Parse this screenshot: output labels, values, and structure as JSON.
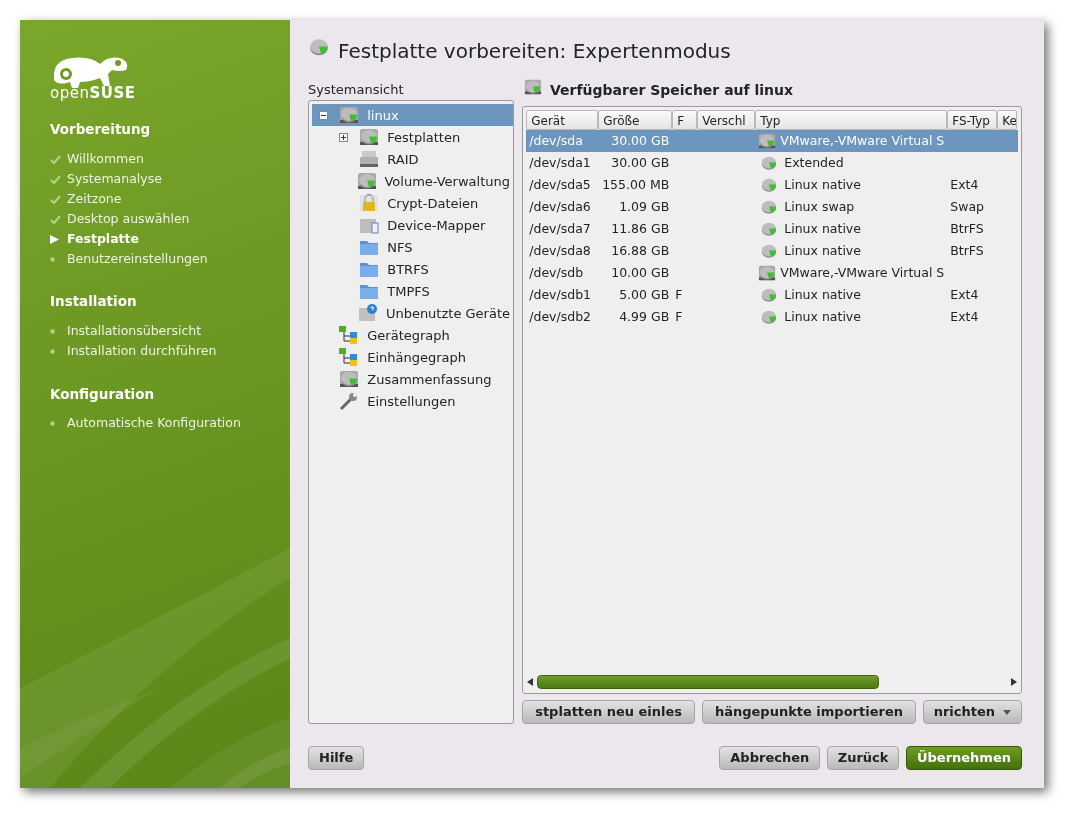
{
  "sidebar": {
    "logo": "open**SUSE**",
    "sections": [
      {
        "title": "Vorbereitung",
        "steps": [
          {
            "label": "Willkommen",
            "done": true,
            "current": false
          },
          {
            "label": "Systemanalyse",
            "done": true,
            "current": false
          },
          {
            "label": "Zeitzone",
            "done": true,
            "current": false
          },
          {
            "label": "Desktop auswählen",
            "done": true,
            "current": false
          },
          {
            "label": "Festplatte",
            "done": false,
            "current": true
          },
          {
            "label": "Benutzereinstellungen",
            "done": false,
            "current": false
          }
        ]
      },
      {
        "title": "Installation",
        "steps": [
          {
            "label": "Installationsübersicht",
            "done": false,
            "current": false
          },
          {
            "label": "Installation durchführen",
            "done": false,
            "current": false
          }
        ]
      },
      {
        "title": "Konfiguration",
        "steps": [
          {
            "label": "Automatische Konfiguration",
            "done": false,
            "current": false
          }
        ]
      }
    ]
  },
  "window": {
    "title": "Festplatte vorbereiten: Expertenmodus"
  },
  "tree": {
    "label": "Systemansicht",
    "items": [
      {
        "label": "linux",
        "kind": "disk",
        "selected": true,
        "expanded": true,
        "children": [
          {
            "label": "Festplatten",
            "kind": "disk",
            "selected": false,
            "expanded": false
          },
          {
            "label": "RAID",
            "kind": "raid",
            "selected": false
          },
          {
            "label": "Volume-Verwaltung",
            "kind": "disk",
            "selected": false
          },
          {
            "label": "Crypt-Dateien",
            "kind": "lock",
            "selected": false
          },
          {
            "label": "Device-Mapper",
            "kind": "mapper",
            "selected": false
          },
          {
            "label": "NFS",
            "kind": "folder",
            "selected": false
          },
          {
            "label": "BTRFS",
            "kind": "folder",
            "selected": false
          },
          {
            "label": "TMPFS",
            "kind": "folder",
            "selected": false
          },
          {
            "label": "Unbenutzte Geräte",
            "kind": "unused",
            "selected": false
          }
        ]
      },
      {
        "label": "Gerätegraph",
        "kind": "graph",
        "selected": false
      },
      {
        "label": "Einhängegraph",
        "kind": "graph",
        "selected": false
      },
      {
        "label": "Zusammenfassung",
        "kind": "disk",
        "selected": false
      },
      {
        "label": "Einstellungen",
        "kind": "wrench",
        "selected": false
      }
    ]
  },
  "storage": {
    "title": "Verfügbarer Speicher auf linux",
    "columns": [
      "Gerät",
      "Größe",
      "F",
      "Verschl",
      "Typ",
      "FS-Typ",
      "Ke"
    ],
    "rows": [
      {
        "device": "/dev/sda",
        "size": "30.00 GB",
        "kind": "disk",
        "type": "VMware,-VMware Virtual S",
        "selected": true
      },
      {
        "device": "/dev/sda1",
        "size": "30.00 GB",
        "kind": "partition",
        "type": "Extended",
        "selected": false
      },
      {
        "device": "/dev/sda5",
        "size": "155.00 MB",
        "kind": "partition",
        "type": "Linux native",
        "fs_type": "Ext4",
        "selected": false
      },
      {
        "device": "/dev/sda6",
        "size": "1.09 GB",
        "kind": "partition",
        "type": "Linux swap",
        "fs_type": "Swap",
        "selected": false
      },
      {
        "device": "/dev/sda7",
        "size": "11.86 GB",
        "kind": "partition",
        "type": "Linux native",
        "fs_type": "BtrFS",
        "selected": false
      },
      {
        "device": "/dev/sda8",
        "size": "16.88 GB",
        "kind": "partition",
        "type": "Linux native",
        "fs_type": "BtrFS",
        "selected": false
      },
      {
        "device": "/dev/sdb",
        "size": "10.00 GB",
        "kind": "disk",
        "type": "VMware,-VMware Virtual S",
        "selected": false
      },
      {
        "device": "/dev/sdb1",
        "size": "5.00 GB",
        "format": "F",
        "kind": "partition",
        "type": "Linux native",
        "fs_type": "Ext4",
        "selected": false
      },
      {
        "device": "/dev/sdb2",
        "size": "4.99 GB",
        "format": "F",
        "kind": "partition",
        "type": "Linux native",
        "fs_type": "Ext4",
        "selected": false
      }
    ],
    "actions": [
      {
        "label": "stplatten neu einles",
        "kind": "button"
      },
      {
        "label": "hängepunkte importieren",
        "kind": "button"
      },
      {
        "label": "nrichten",
        "kind": "dropdown"
      }
    ]
  },
  "footer": {
    "left": [
      {
        "label": "Hilfe",
        "default": false
      }
    ],
    "right": [
      {
        "label": "Abbrechen",
        "default": false
      },
      {
        "label": "Zurück",
        "default": false
      },
      {
        "label": "Übernehmen",
        "default": true
      }
    ]
  }
}
